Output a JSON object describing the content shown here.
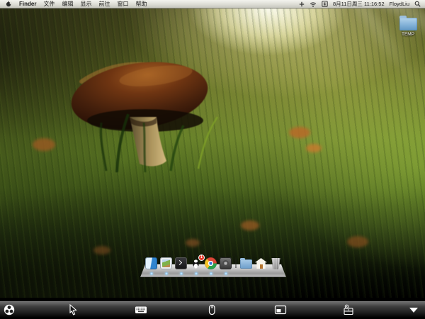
{
  "menu_bar": {
    "menus": [
      {
        "label": "Finder"
      },
      {
        "label": "文件"
      },
      {
        "label": "编辑"
      },
      {
        "label": "显示"
      },
      {
        "label": "前往"
      },
      {
        "label": "窗口"
      },
      {
        "label": "帮助"
      }
    ],
    "status": {
      "clock": "8月11日周三 11:16:52",
      "user": "FloydLiu"
    },
    "icons": [
      "apple-menu-icon",
      "plus-icon",
      "wifi-icon",
      "input-source-icon",
      "spotlight-icon"
    ]
  },
  "desktop": {
    "icons": [
      {
        "label": "TEMP",
        "type": "folder"
      }
    ],
    "wallpaper_description": ""
  },
  "dock": {
    "items": [
      {
        "name": "finder",
        "running": true
      },
      {
        "name": "preview",
        "running": true
      },
      {
        "name": "terminal",
        "running": true
      },
      {
        "name": "qq",
        "running": true,
        "badge": "1"
      },
      {
        "name": "chrome",
        "running": true
      },
      {
        "name": "screen-sharing",
        "running": true
      },
      {
        "name": "documents-folder",
        "running": false
      },
      {
        "name": "home-stack",
        "running": false
      },
      {
        "name": "trash",
        "running": false
      }
    ]
  },
  "vnc_toolbar": {
    "buttons": [
      "connections",
      "cursor",
      "keyboard",
      "mouse",
      "display",
      "tools",
      "hide"
    ]
  },
  "colors": {
    "menu_bar": "#e4e4dc",
    "dock_shelf": "#c6c6c6",
    "toolbar_dark": "#2b2b2b",
    "badge_red": "#e0392b",
    "folder_blue": "#7fb0d8",
    "running_indicator": "#aaddff"
  }
}
